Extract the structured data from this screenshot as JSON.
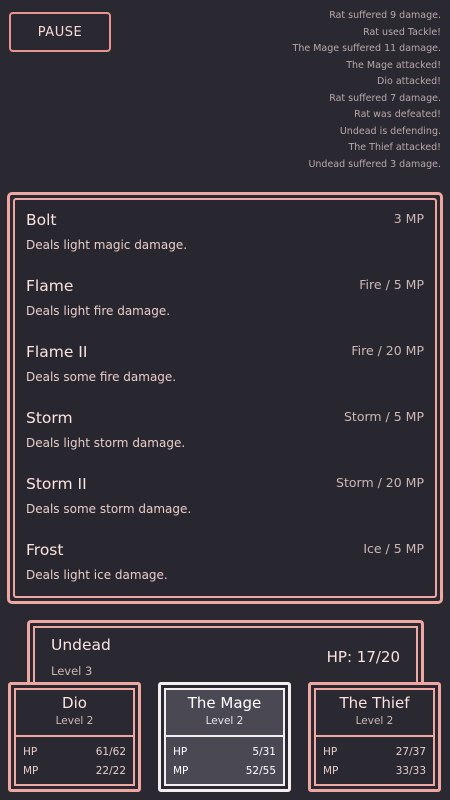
{
  "pause_label": "PAUSE",
  "battle_log": [
    "Rat suffered 9 damage.",
    "Rat used Tackle!",
    "The Mage suffered 11 damage.",
    "The Mage attacked!",
    "Dio attacked!",
    "Rat suffered 7 damage.",
    "Rat was defeated!",
    "Undead is defending.",
    "The Thief attacked!",
    "Undead suffered 3 damage."
  ],
  "spells": [
    {
      "name": "Bolt",
      "cost": "3 MP",
      "desc": "Deals light magic damage."
    },
    {
      "name": "Flame",
      "cost": "Fire / 5 MP",
      "desc": "Deals light fire damage."
    },
    {
      "name": "Flame II",
      "cost": "Fire / 20 MP",
      "desc": "Deals some fire damage."
    },
    {
      "name": "Storm",
      "cost": "Storm / 5 MP",
      "desc": "Deals light storm damage."
    },
    {
      "name": "Storm II",
      "cost": "Storm / 20 MP",
      "desc": "Deals some storm damage."
    },
    {
      "name": "Frost",
      "cost": "Ice / 5 MP",
      "desc": "Deals light ice damage."
    }
  ],
  "enemy": {
    "name": "Undead",
    "level": "Level 3",
    "hp": "HP: 17/20"
  },
  "party": [
    {
      "name": "Dio",
      "level": "Level 2",
      "hp_label": "HP",
      "hp": "61/62",
      "mp_label": "MP",
      "mp": "22/22",
      "active": false
    },
    {
      "name": "The Mage",
      "level": "Level 2",
      "hp_label": "HP",
      "hp": "5/31",
      "mp_label": "MP",
      "mp": "52/55",
      "active": true
    },
    {
      "name": "The Thief",
      "level": "Level 2",
      "hp_label": "HP",
      "hp": "27/37",
      "mp_label": "MP",
      "mp": "33/33",
      "active": false
    }
  ],
  "colors": {
    "background": "#2a2931",
    "accent": "#efa7a1",
    "active": "#f5eef0"
  }
}
